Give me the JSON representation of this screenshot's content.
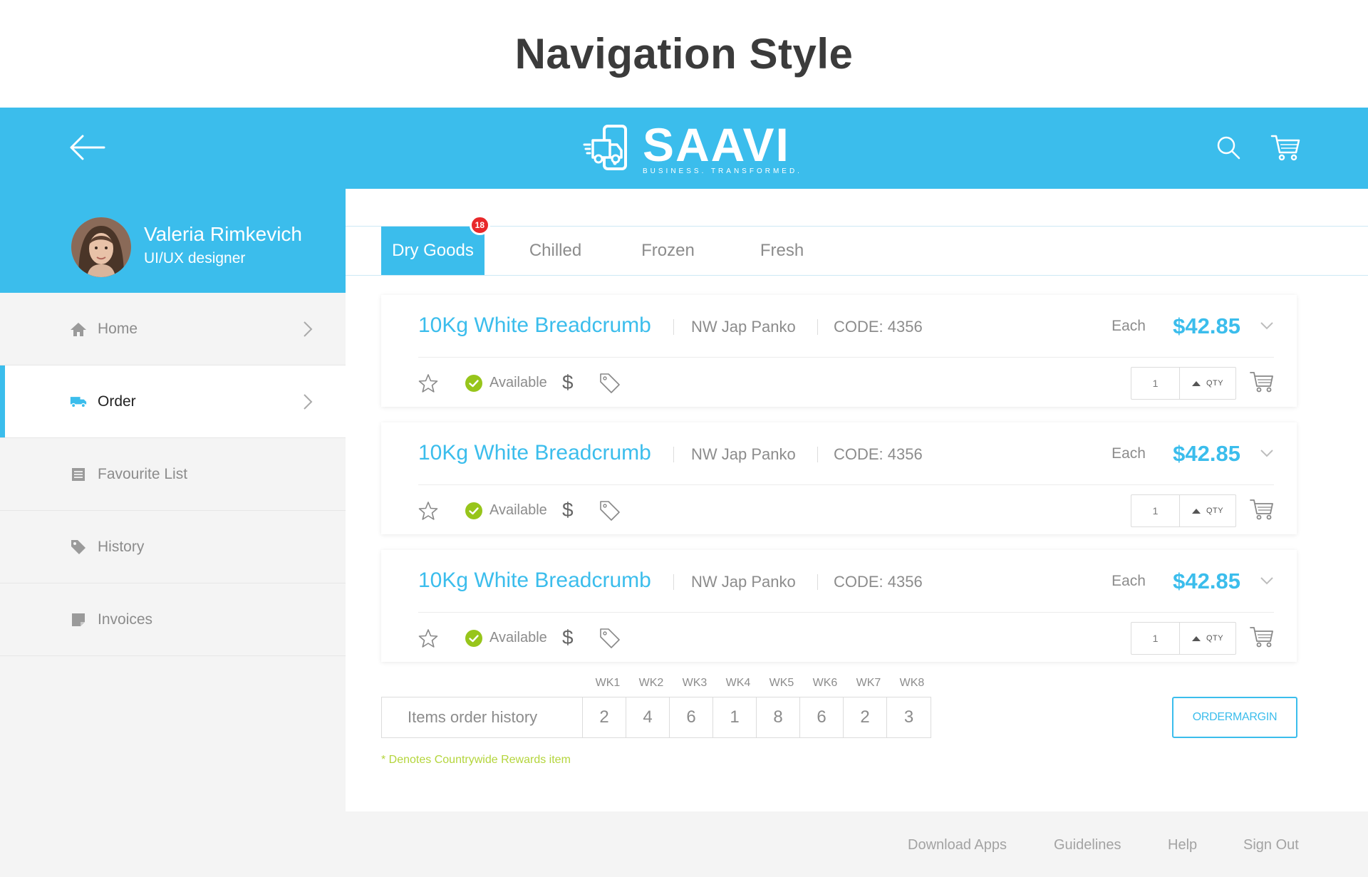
{
  "page_heading": "Navigation Style",
  "brand": {
    "name": "SAAVI",
    "tagline": "BUSINESS. TRANSFORMED."
  },
  "profile": {
    "name": "Valeria Rimkevich",
    "role": "UI/UX designer"
  },
  "sidebar": {
    "items": [
      {
        "label": "Home",
        "icon": "home-icon"
      },
      {
        "label": "Order",
        "icon": "truck-icon",
        "active": true
      },
      {
        "label": "Favourite List",
        "icon": "list-icon"
      },
      {
        "label": "History",
        "icon": "tag-icon"
      },
      {
        "label": "Invoices",
        "icon": "invoice-icon"
      }
    ]
  },
  "tabs": [
    {
      "label": "Dry Goods",
      "badge": "18",
      "active": true
    },
    {
      "label": "Chilled"
    },
    {
      "label": "Frozen"
    },
    {
      "label": "Fresh"
    }
  ],
  "products": [
    {
      "name": "10Kg White Breadcrumb",
      "brand": "NW Jap Panko",
      "code": "CODE: 4356",
      "unit": "Each",
      "price": "$42.85",
      "availability": "Available",
      "qty": "1",
      "qty_label": "QTY"
    },
    {
      "name": "10Kg White Breadcrumb",
      "brand": "NW Jap Panko",
      "code": "CODE: 4356",
      "unit": "Each",
      "price": "$42.85",
      "availability": "Available",
      "qty": "1",
      "qty_label": "QTY"
    },
    {
      "name": "10Kg White Breadcrumb",
      "brand": "NW Jap Panko",
      "code": "CODE: 4356",
      "unit": "Each",
      "price": "$42.85",
      "availability": "Available",
      "qty": "1",
      "qty_label": "QTY"
    }
  ],
  "order_history": {
    "label": "Items order history",
    "weeks": [
      "WK1",
      "WK2",
      "WK3",
      "WK4",
      "WK5",
      "WK6",
      "WK7",
      "WK8"
    ],
    "values": [
      "2",
      "4",
      "6",
      "1",
      "8",
      "6",
      "2",
      "3"
    ]
  },
  "order_margin_button": "ORDERMARGIN",
  "rewards_note": "* Denotes Countrywide Rewards item",
  "footer": {
    "links": [
      "Download Apps",
      "Guidelines",
      "Help",
      "Sign Out"
    ]
  },
  "colors": {
    "accent": "#3bbdec",
    "badge": "#e8282a",
    "available": "#97c51b",
    "rewards": "#b4d53c"
  }
}
